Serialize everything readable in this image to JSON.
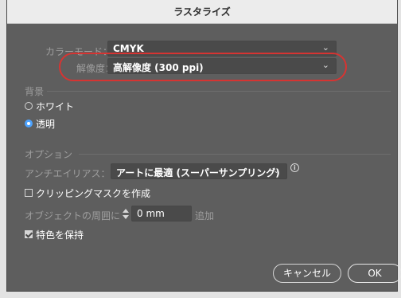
{
  "window": {
    "title": "ラスタライズ"
  },
  "color_mode": {
    "label": "カラーモード：",
    "value": "CMYK"
  },
  "resolution": {
    "label": "解像度：",
    "value": "高解像度 (300 ppi)"
  },
  "background": {
    "heading": "背景",
    "options": [
      {
        "label": "ホワイト",
        "selected": false
      },
      {
        "label": "透明",
        "selected": true
      }
    ]
  },
  "options": {
    "heading": "オプション",
    "antialias": {
      "label": "アンチエイリアス：",
      "value": "アートに最適 (スーパーサンプリング)"
    },
    "clipping_mask": {
      "label": "クリッピングマスクを作成",
      "checked": false
    },
    "surround": {
      "label": "オブジェクトの周囲に",
      "value": "0 mm",
      "suffix": "追加"
    },
    "preserve_spot": {
      "label": "特色を保持",
      "checked": true
    }
  },
  "buttons": {
    "cancel": "キャンセル",
    "ok": "OK"
  },
  "colors": {
    "panel": "#5e5e5e",
    "highlight": "#d63432",
    "radio_selected": "#4da3ff"
  }
}
